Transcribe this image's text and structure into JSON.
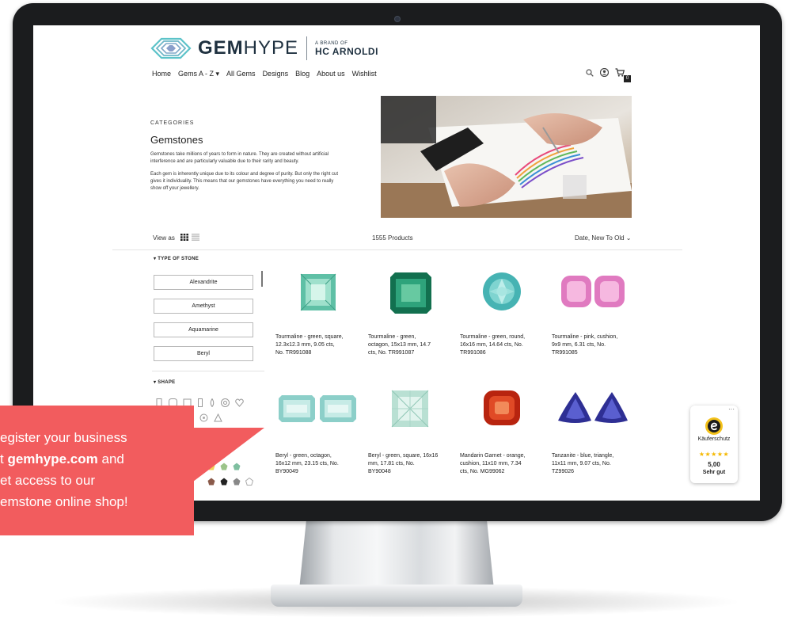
{
  "brand": {
    "logo_word_bold": "GEM",
    "logo_word_light": "HYPE",
    "brand_of": "A BRAND OF",
    "parent": "HC ARNOLDI"
  },
  "nav": {
    "items": [
      "Home",
      "Gems A - Z ▾",
      "All Gems",
      "Designs",
      "Blog",
      "About us",
      "Wishlist"
    ],
    "cart_count": "0",
    "icons": [
      "search-icon",
      "account-icon",
      "cart-icon"
    ]
  },
  "hero": {
    "eyebrow": "CATEGORIES",
    "title": "Gemstones",
    "paragraph1_lines": [
      "Gemstones take millions of years to form in nature. They are created without artificial",
      "interference and are particularly valuable due to their rarity and beauty."
    ],
    "paragraph2_lines": [
      "Each gem is inherently unique due to its colour and degree of purity. But only the right cut",
      "gives it individuality. This means that our gemstones have everything you need to really",
      "show off your jewellery."
    ]
  },
  "toolbar": {
    "view_as": "View as",
    "product_count": "1555  Products",
    "sort": "Date, New To Old  ⌄"
  },
  "filters": {
    "type_heading": "▾  TYPE OF STONE",
    "stones": [
      "Alexandrite",
      "Amethyst",
      "Aquamarine",
      "Beryl"
    ],
    "shape_heading": "▾  SHAPE"
  },
  "products": [
    {
      "lines": [
        "Tourmaline - green, square,",
        "12.3x12.3 mm, 9.05 cts,",
        "No. TR991088"
      ],
      "color": "#6fcfb6"
    },
    {
      "lines": [
        "Tourmaline - green,",
        "octagon, 15x13 mm, 14.7",
        "cts, No. TR991087"
      ],
      "color": "#1f8a6a"
    },
    {
      "lines": [
        "Tourmaline - green, round,",
        "16x16 mm, 14.64 cts, No.",
        "TR991086"
      ],
      "color": "#5fc3c3"
    },
    {
      "lines": [
        "Tourmaline - pink, cushion,",
        "9x9 mm, 6.31 cts, No.",
        "TR991085"
      ],
      "color": "#e88fc9"
    },
    {
      "lines": [
        "Beryl - green, octagon,",
        "16x12 mm, 23.15 cts, No.",
        "BY90049"
      ],
      "color": "#9ed3cf"
    },
    {
      "lines": [
        "Beryl - green, square, 16x16",
        "mm, 17.81 cts, No.",
        "BY90048"
      ],
      "color": "#c7e5dc"
    },
    {
      "lines": [
        "Mandarin Garnet - orange,",
        "cushion, 11x10 mm, 7.34",
        "cts, No. MG99062"
      ],
      "color": "#d23a1f"
    },
    {
      "lines": [
        "Tanzanite - blue, triangle,",
        "11x11 mm, 9.07 cts, No.",
        "TZ99026"
      ],
      "color": "#3b3fa8"
    }
  ],
  "trust_badge": {
    "label": "Käuferschutz",
    "stars": "★★★★★",
    "score": "5,00",
    "rating": "Sehr gut",
    "more": "···"
  },
  "promo": {
    "lines": [
      "egister your business",
      "t gemhype.com and",
      "et access to our",
      "emstone online shop!"
    ],
    "bold_fragment": "gemhype.com",
    "color": "#f25c5e"
  }
}
